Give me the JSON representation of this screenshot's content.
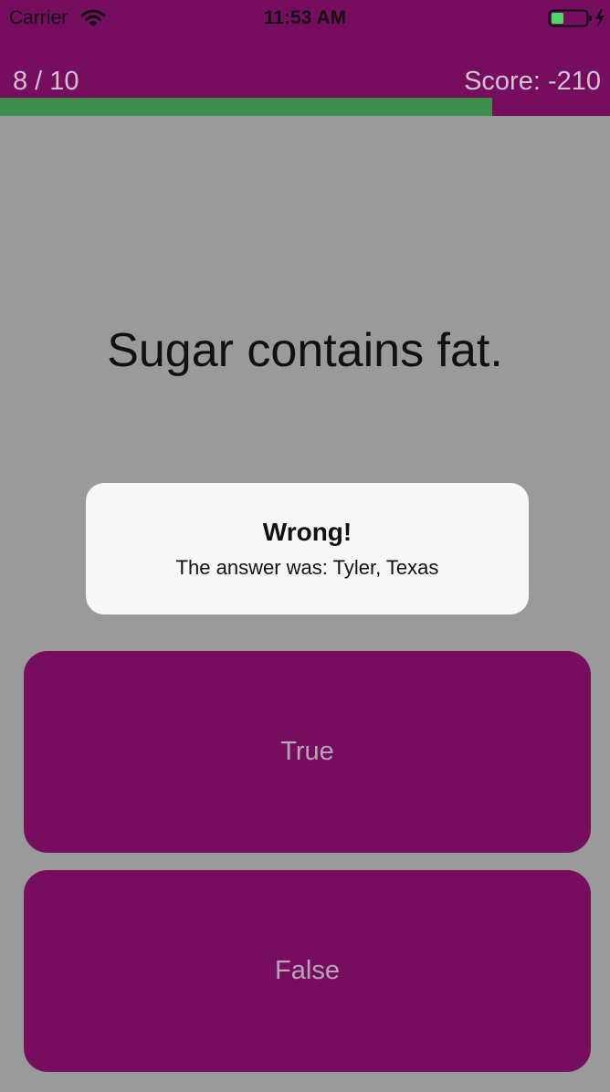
{
  "status_bar": {
    "carrier": "Carrier",
    "time": "11:53 AM",
    "icons": [
      "wifi-icon",
      "battery-charging-icon"
    ]
  },
  "header": {
    "progress_label": "8 / 10",
    "score_label": "Score: -210",
    "progress_fraction": 0.807
  },
  "question": {
    "text": "Sugar contains fat."
  },
  "feedback": {
    "title": "Wrong!",
    "message": "The answer was: Tyler, Texas"
  },
  "answers": {
    "true_label": "True",
    "false_label": "False"
  },
  "colors": {
    "brand": "#770d5e",
    "background": "#9a9a9a",
    "progress": "#3c8f4b",
    "battery": "#4cd964",
    "button_text": "#b6a5b4"
  }
}
